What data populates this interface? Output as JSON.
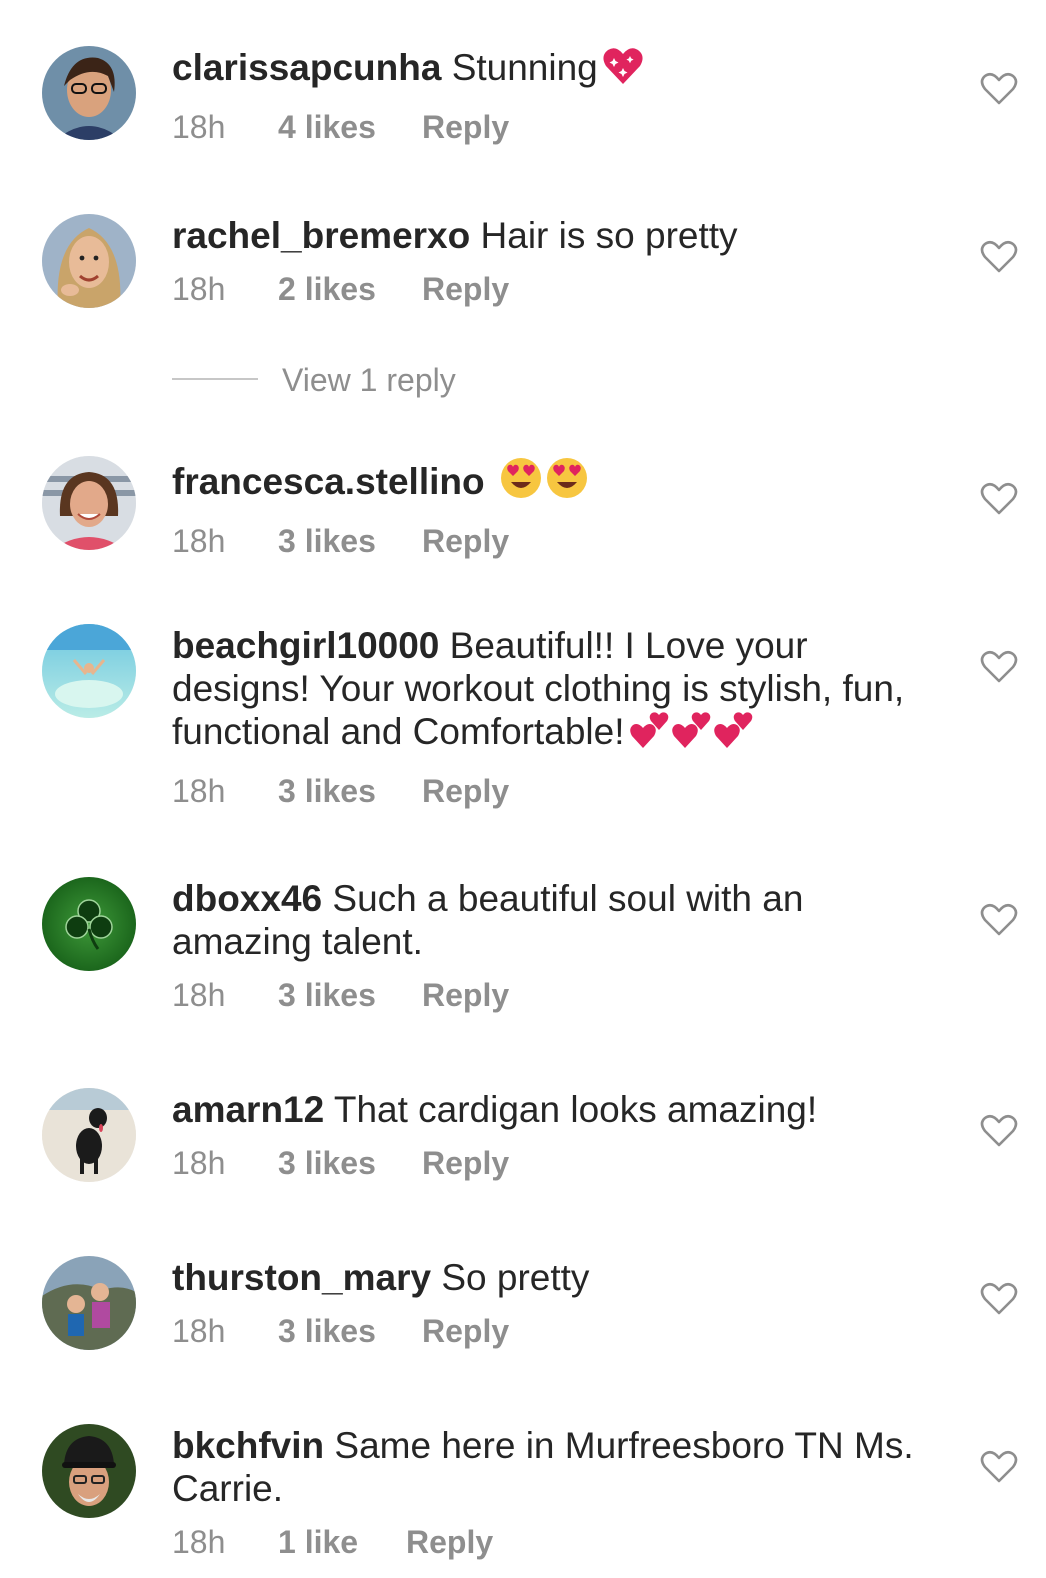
{
  "comments": [
    {
      "username": "clarissapcunha",
      "text": "Stunning",
      "emoji": [
        "sparkling-heart"
      ],
      "time": "18h",
      "likes": "4 likes",
      "reply": "Reply"
    },
    {
      "username": "rachel_bremerxo",
      "text": "Hair is so pretty",
      "emoji": [],
      "time": "18h",
      "likes": "2 likes",
      "reply": "Reply"
    },
    {
      "username": "francesca.stellino",
      "text": "",
      "emoji": [
        "heart-eyes",
        "heart-eyes"
      ],
      "time": "18h",
      "likes": "3 likes",
      "reply": "Reply"
    },
    {
      "username": "beachgirl10000",
      "text": "Beautiful!! I Love your designs! Your workout clothing is stylish, fun, functional and Comfortable!",
      "emoji": [
        "two-hearts",
        "two-hearts",
        "two-hearts"
      ],
      "time": "18h",
      "likes": "3 likes",
      "reply": "Reply"
    },
    {
      "username": "dboxx46",
      "text": "Such a beautiful soul with an amazing talent.",
      "emoji": [],
      "time": "18h",
      "likes": "3 likes",
      "reply": "Reply"
    },
    {
      "username": "amarn12",
      "text": "That cardigan looks amazing!",
      "emoji": [],
      "time": "18h",
      "likes": "3 likes",
      "reply": "Reply"
    },
    {
      "username": "thurston_mary",
      "text": "So pretty",
      "emoji": [],
      "time": "18h",
      "likes": "3 likes",
      "reply": "Reply"
    },
    {
      "username": "bkchfvin",
      "text": "Same here in Murfreesboro TN Ms. Carrie.",
      "emoji": [],
      "time": "18h",
      "likes": "1 like",
      "reply": "Reply"
    }
  ],
  "view_replies": "View 1 reply",
  "colors": {
    "text": "#262626",
    "muted": "#8e8e8e",
    "heart": "#8e8e8e",
    "emoji_red": "#e0245e"
  }
}
